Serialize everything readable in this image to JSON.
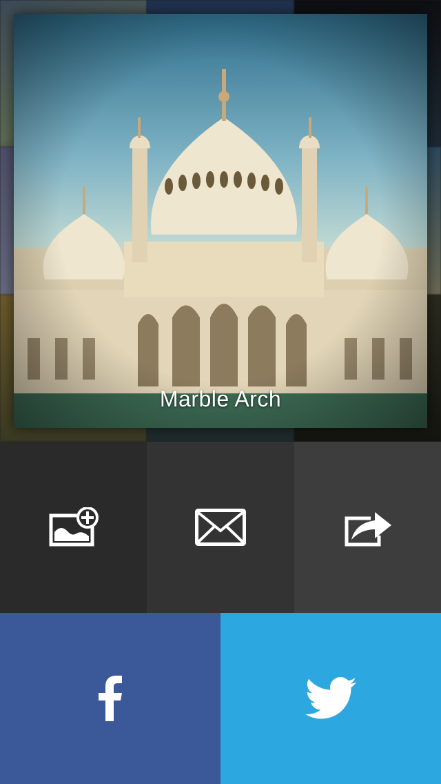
{
  "photo": {
    "caption": "Marble Arch"
  },
  "actions": [
    {
      "id": "save-image",
      "icon": "add-photo-icon"
    },
    {
      "id": "email",
      "icon": "mail-icon"
    },
    {
      "id": "share",
      "icon": "share-icon"
    }
  ],
  "social": {
    "facebook": {
      "icon": "facebook-icon",
      "color": "#3b5998"
    },
    "twitter": {
      "icon": "twitter-icon",
      "color": "#2ca7e0"
    }
  },
  "colors": {
    "tile_dark": "#2a2a2a",
    "tile_mid": "#333333",
    "tile_light": "#3d3d3d"
  }
}
